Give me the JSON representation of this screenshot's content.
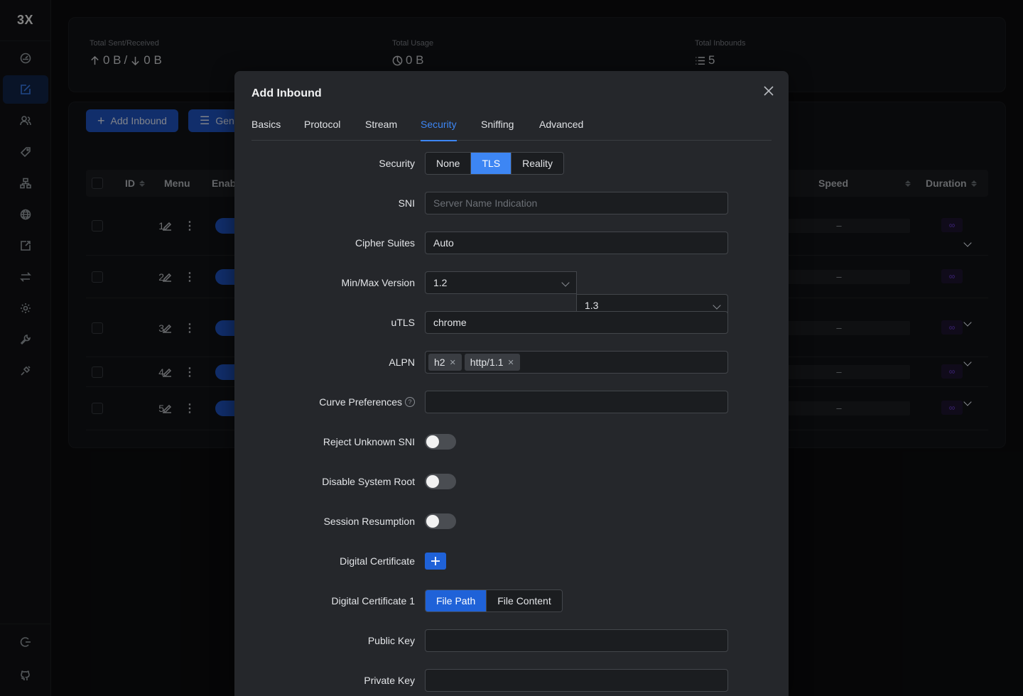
{
  "app": {
    "logo": "3X"
  },
  "sidebar": {
    "items": [
      {
        "icon": "dashboard-icon"
      },
      {
        "icon": "inbounds-icon",
        "active": true
      },
      {
        "icon": "users-icon"
      },
      {
        "icon": "tag-icon"
      },
      {
        "icon": "sitemap-icon"
      },
      {
        "icon": "globe-icon"
      },
      {
        "icon": "export-icon"
      },
      {
        "icon": "swap-icon"
      },
      {
        "icon": "settings-icon"
      },
      {
        "icon": "tool-icon"
      },
      {
        "icon": "api-icon"
      }
    ],
    "bottom": [
      {
        "icon": "logout-icon"
      },
      {
        "icon": "github-icon"
      }
    ]
  },
  "stats": {
    "sent_received": {
      "label": "Total Sent/Received",
      "up": "0 B",
      "separator": "/",
      "down": "0 B"
    },
    "usage": {
      "label": "Total Usage",
      "value": "0 B"
    },
    "inbounds": {
      "label": "Total Inbounds",
      "value": "5"
    }
  },
  "toolbar": {
    "add_inbound": "Add Inbound",
    "general": "Gen"
  },
  "table": {
    "headers": {
      "id": "ID",
      "menu": "Menu",
      "enable": "Enab",
      "speed": "Speed",
      "duration": "Duration"
    },
    "rows": [
      {
        "id": "1",
        "speed": "–",
        "duration": "∞"
      },
      {
        "id": "2",
        "speed": "–",
        "duration": "∞"
      },
      {
        "id": "3",
        "speed": "–",
        "duration": "∞"
      },
      {
        "id": "4",
        "speed": "–",
        "duration": "∞"
      },
      {
        "id": "5",
        "speed": "–",
        "duration": "∞"
      }
    ]
  },
  "modal": {
    "title": "Add Inbound",
    "tabs": [
      "Basics",
      "Protocol",
      "Stream",
      "Security",
      "Sniffing",
      "Advanced"
    ],
    "active_tab": "Security",
    "form": {
      "security": {
        "label": "Security",
        "options": [
          "None",
          "TLS",
          "Reality"
        ],
        "selected": "TLS"
      },
      "sni": {
        "label": "SNI",
        "placeholder": "Server Name Indication",
        "value": ""
      },
      "cipher_suites": {
        "label": "Cipher Suites",
        "value": "Auto"
      },
      "min_max_version": {
        "label": "Min/Max Version",
        "min": "1.2",
        "max": "1.3"
      },
      "utls": {
        "label": "uTLS",
        "value": "chrome"
      },
      "alpn": {
        "label": "ALPN",
        "tags": [
          "h2",
          "http/1.1"
        ]
      },
      "curve_preferences": {
        "label": "Curve Preferences",
        "help": "?",
        "value": ""
      },
      "reject_unknown_sni": {
        "label": "Reject Unknown SNI",
        "on": false
      },
      "disable_system_root": {
        "label": "Disable System Root",
        "on": false
      },
      "session_resumption": {
        "label": "Session Resumption",
        "on": false
      },
      "digital_certificate": {
        "label": "Digital Certificate"
      },
      "digital_certificate_1": {
        "label": "Digital Certificate 1",
        "options": [
          "File Path",
          "File Content"
        ],
        "selected": "File Path"
      },
      "public_key": {
        "label": "Public Key",
        "value": ""
      },
      "private_key": {
        "label": "Private Key",
        "value": ""
      }
    }
  }
}
